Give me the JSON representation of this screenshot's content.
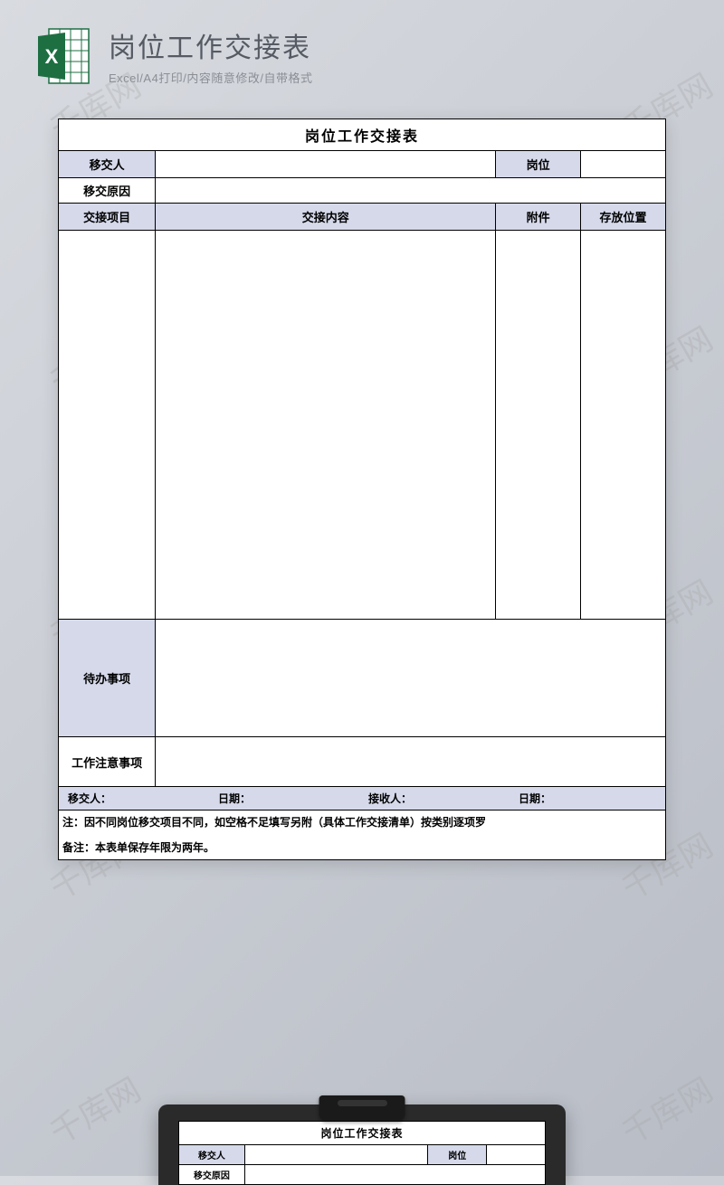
{
  "header": {
    "title": "岗位工作交接表",
    "subtitle": "Excel/A4打印/内容随意修改/自带格式"
  },
  "form": {
    "main_title": "岗位工作交接表",
    "transferrer_label": "移交人",
    "position_label": "岗位",
    "reason_label": "移交原因",
    "item_label": "交接项目",
    "content_label": "交接内容",
    "attachment_label": "附件",
    "location_label": "存放位置",
    "pending_label": "待办事项",
    "notes_label": "工作注意事项",
    "sig_transferrer": "移交人：",
    "sig_date1": "日期：",
    "sig_receiver": "接收人：",
    "sig_date2": "日期：",
    "note1": "注：因不同岗位移交项目不同，如空格不足填写另附（具体工作交接清单）按类别逐项罗",
    "note2": "备注：本表单保存年限为两年。"
  },
  "watermark_text": "千库网",
  "colors": {
    "header_bg": "#d5d9ea",
    "page_bg": "#d8dbe0"
  }
}
